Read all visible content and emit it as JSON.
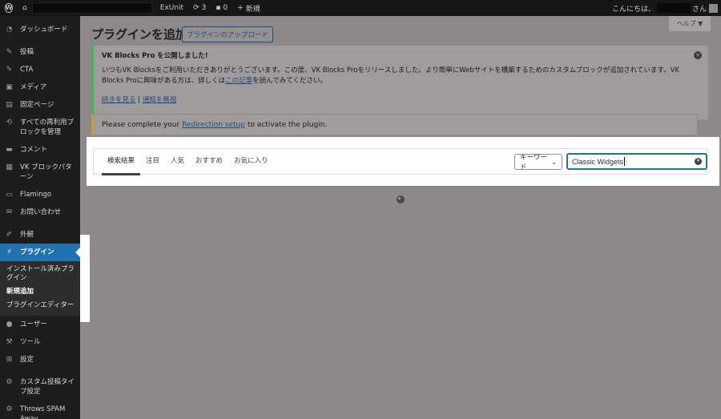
{
  "adminbar": {
    "site_name": "ExUnit",
    "updates_count": "3",
    "comments_count": "0",
    "new_label": "新規",
    "greeting": "こんにちは、",
    "greeting_suffix": "さん"
  },
  "sidebar": {
    "items": [
      {
        "label": "ダッシュボード",
        "icon": "dashboard-icon"
      },
      {
        "label": "投稿",
        "icon": "pin-icon"
      },
      {
        "label": "CTA",
        "icon": "pin-icon"
      },
      {
        "label": "メディア",
        "icon": "media-icon"
      },
      {
        "label": "固定ページ",
        "icon": "page-icon"
      },
      {
        "label": "すべての再利用ブロックを管理",
        "icon": "reusable-block-icon"
      },
      {
        "label": "コメント",
        "icon": "comment-icon"
      },
      {
        "label": "VK ブロックパターン",
        "icon": "pattern-icon"
      },
      {
        "label": "Flamingo",
        "icon": "flamingo-icon"
      },
      {
        "label": "お問い合わせ",
        "icon": "mail-icon"
      },
      {
        "label": "外観",
        "icon": "brush-icon"
      },
      {
        "label": "プラグイン",
        "icon": "plugin-icon"
      },
      {
        "label": "ユーザー",
        "icon": "user-icon"
      },
      {
        "label": "ツール",
        "icon": "wrench-icon"
      },
      {
        "label": "設定",
        "icon": "settings-icon"
      },
      {
        "label": "カスタム投稿タイプ設定",
        "icon": "gear-icon"
      },
      {
        "label": "Throws SPAM Away",
        "icon": "gear-icon"
      }
    ],
    "plugin_submenu": [
      "インストール済みプラグイン",
      "新規追加",
      "プラグインエディター"
    ]
  },
  "main": {
    "title": "プラグインを追加",
    "upload_button": "プラグインのアップロード",
    "help": "ヘルプ ▼",
    "vk_notice": {
      "title": "VK Blocks Pro を公開しました!",
      "body_prefix": "いつもVK Blocksをご利用いただきありがとうございます。この度、VK Blocks Proをリリースしました。より簡単にWebサイトを構築するためのカスタムブロックが追加されています。VK Blocks Proに興味がある方は、詳しくは",
      "body_link": "この記事",
      "body_suffix": "を読んでみてください。",
      "link_more": "続きを見る",
      "separator": "|",
      "link_dismiss": "通知を無視"
    },
    "redirection_notice": {
      "prefix": "Please complete your ",
      "link": "Redirection setup",
      "suffix": " to activate the plugin."
    },
    "filter_tabs": [
      "検索結果",
      "注目",
      "人気",
      "おすすめ",
      "お気に入り"
    ],
    "search_type": "キーワード",
    "search_value": "Classic Widgets"
  }
}
